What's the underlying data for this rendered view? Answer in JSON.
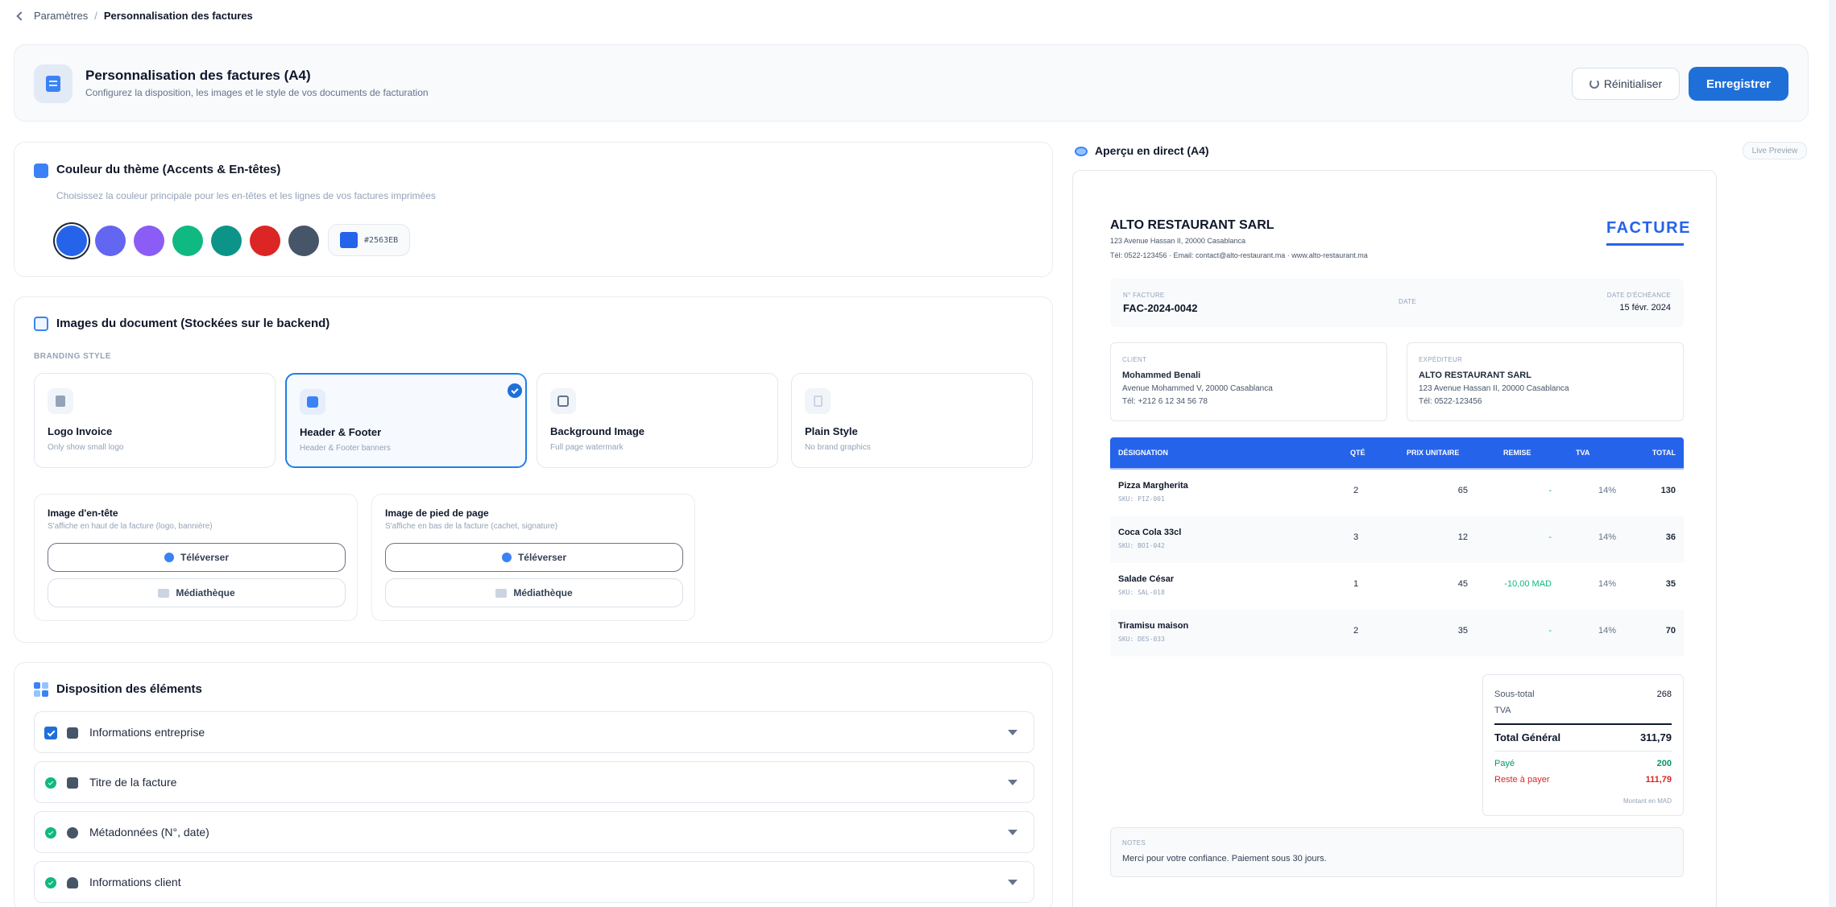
{
  "breadcrumb": {
    "parent": "Paramètres",
    "separator": "/",
    "current": "Personnalisation des factures"
  },
  "header": {
    "title": "Personnalisation des factures (A4)",
    "subtitle": "Configurez la disposition, les images et le style de vos documents de facturation",
    "reset_label": "Réinitialiser",
    "save_label": "Enregistrer"
  },
  "theme": {
    "title": "Couleur du thème (Accents & En-têtes)",
    "subtitle": "Choisissez la couleur principale pour les en-têtes et les lignes de vos factures imprimées",
    "swatches": [
      "#2563eb",
      "#6366f1",
      "#8b5cf6",
      "#10b981",
      "#0d9488",
      "#dc2626",
      "#475569"
    ],
    "selected_index": 0,
    "hex_value": "#2563EB"
  },
  "images": {
    "title": "Images du document (Stockées sur le backend)",
    "branding_label": "BRANDING STYLE",
    "styles": [
      {
        "title": "Logo Invoice",
        "subtitle": "Only show small logo",
        "icon": "logo-icon",
        "selected": false
      },
      {
        "title": "Header & Footer",
        "subtitle": "Header & Footer banners",
        "icon": "header-footer-icon",
        "selected": true
      },
      {
        "title": "Background Image",
        "subtitle": "Full page watermark",
        "icon": "background-image-icon",
        "selected": false
      },
      {
        "title": "Plain Style",
        "subtitle": "No brand graphics",
        "icon": "plain-doc-icon",
        "selected": false
      }
    ],
    "header_image": {
      "title": "Image d'en-tête",
      "subtitle": "S'affiche en haut de la facture (logo, bannière)",
      "upload": "Téléverser",
      "library": "Médiathèque"
    },
    "footer_image": {
      "title": "Image de pied de page",
      "subtitle": "S'affiche en bas de la facture (cachet, signature)",
      "upload": "Téléverser",
      "library": "Médiathèque"
    }
  },
  "layout": {
    "title": "Disposition des éléments",
    "items": [
      {
        "label": "Informations entreprise",
        "icon": "store-icon",
        "state": "checkbox"
      },
      {
        "label": "Titre de la facture",
        "icon": "document-icon",
        "state": "ok"
      },
      {
        "label": "Métadonnées (N°, date)",
        "icon": "info-icon",
        "state": "ok"
      },
      {
        "label": "Informations client",
        "icon": "user-icon",
        "state": "ok"
      }
    ]
  },
  "preview": {
    "title": "Aperçu en direct (A4)",
    "badge": "Live Preview",
    "company": "ALTO RESTAURANT SARL",
    "company_address": "123 Avenue Hassan II, 20000 Casablanca",
    "company_contact": "Tél: 0522-123456 · Email: contact@alto-restaurant.ma · www.alto-restaurant.ma",
    "doc_title": "FACTURE",
    "meta": {
      "number_label": "N° FACTURE",
      "number": "FAC-2024-0042",
      "date_label": "DATE",
      "due_label": "DATE D'ÉCHÉANCE",
      "due": "15 févr. 2024"
    },
    "client": {
      "label": "CLIENT",
      "name": "Mohammed Benali",
      "address": "Avenue Mohammed V, 20000 Casablanca",
      "phone": "Tél: +212 6 12 34 56 78"
    },
    "sender": {
      "label": "EXPÉDITEUR",
      "name": "ALTO RESTAURANT SARL",
      "address": "123 Avenue Hassan II, 20000 Casablanca",
      "phone": "Tél: 0522-123456"
    },
    "table": {
      "headers": [
        "DÉSIGNATION",
        "QTÉ",
        "PRIX UNITAIRE",
        "REMISE",
        "TVA",
        "TOTAL"
      ],
      "rows": [
        {
          "name": "Pizza Margherita",
          "sku": "SKU: PIZ-001",
          "qty": "2",
          "price": "65",
          "discount": "-",
          "tva": "14%",
          "total": "130"
        },
        {
          "name": "Coca Cola 33cl",
          "sku": "SKU: BOI-042",
          "qty": "3",
          "price": "12",
          "discount": "-",
          "tva": "14%",
          "total": "36"
        },
        {
          "name": "Salade César",
          "sku": "SKU: SAL-018",
          "qty": "1",
          "price": "45",
          "discount": "-10,00 MAD",
          "tva": "14%",
          "total": "35"
        },
        {
          "name": "Tiramisu maison",
          "sku": "SKU: DES-033",
          "qty": "2",
          "price": "35",
          "discount": "-",
          "tva": "14%",
          "total": "70"
        }
      ]
    },
    "totals": {
      "subtotal_label": "Sous-total",
      "subtotal": "268",
      "tva_label": "TVA",
      "grand_label": "Total Général",
      "grand": "311,79",
      "paid_label": "Payé",
      "paid": "200",
      "due_label": "Reste à payer",
      "due": "111,79",
      "currency_note": "Montant en MAD"
    },
    "notes": {
      "label": "NOTES",
      "text": "Merci pour votre confiance. Paiement sous 30 jours."
    }
  }
}
